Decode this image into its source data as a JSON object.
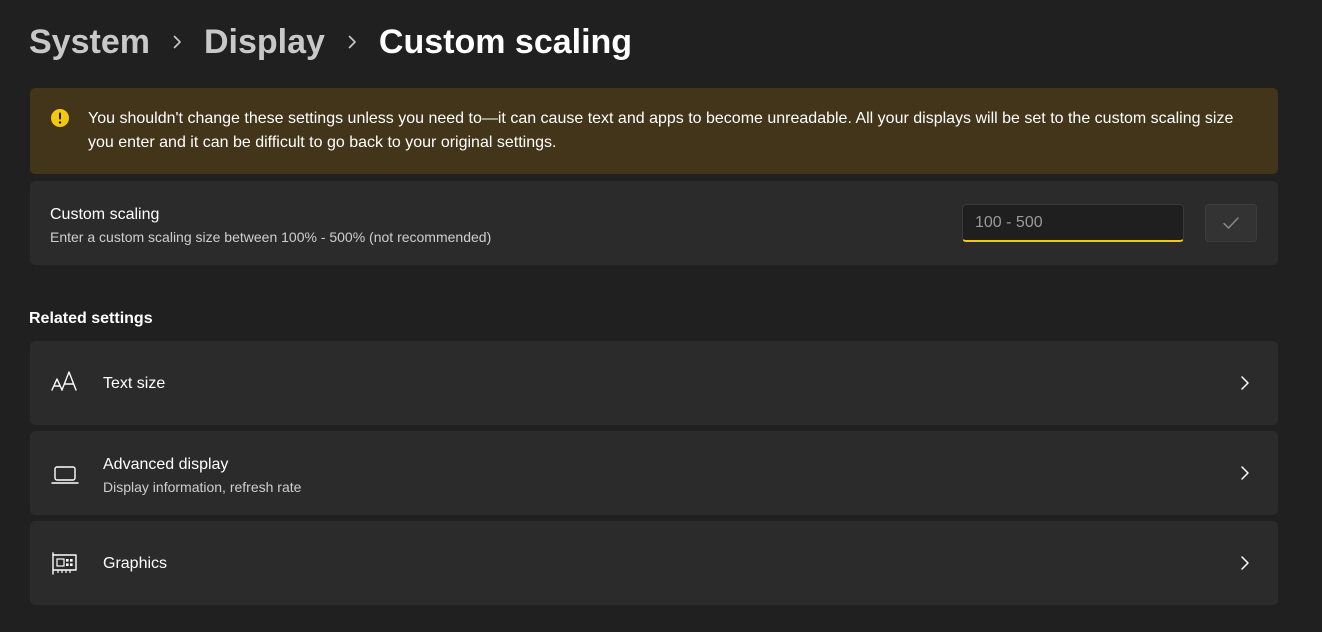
{
  "breadcrumb": {
    "items": [
      "System",
      "Display"
    ],
    "current": "Custom scaling"
  },
  "warning": {
    "icon": "warning-icon",
    "text": "You shouldn't change these settings unless you need to—it can cause text and apps to become unreadable. All your displays will be set to the custom scaling size you enter and it can be difficult to go back to your original settings."
  },
  "custom_scaling": {
    "title": "Custom scaling",
    "description": "Enter a custom scaling size between 100% - 500% (not recommended)",
    "input_value": "",
    "input_placeholder": "100 - 500",
    "apply_icon": "checkmark-icon"
  },
  "related": {
    "heading": "Related settings",
    "items": [
      {
        "title": "Text size",
        "subtitle": "",
        "icon": "text-size-icon"
      },
      {
        "title": "Advanced display",
        "subtitle": "Display information, refresh rate",
        "icon": "laptop-icon"
      },
      {
        "title": "Graphics",
        "subtitle": "",
        "icon": "graphics-card-icon"
      }
    ]
  },
  "colors": {
    "background": "#202020",
    "card": "#2b2b2b",
    "warning_background": "#433519",
    "warning_icon": "#f2c811",
    "input_accent": "#f2c811"
  }
}
